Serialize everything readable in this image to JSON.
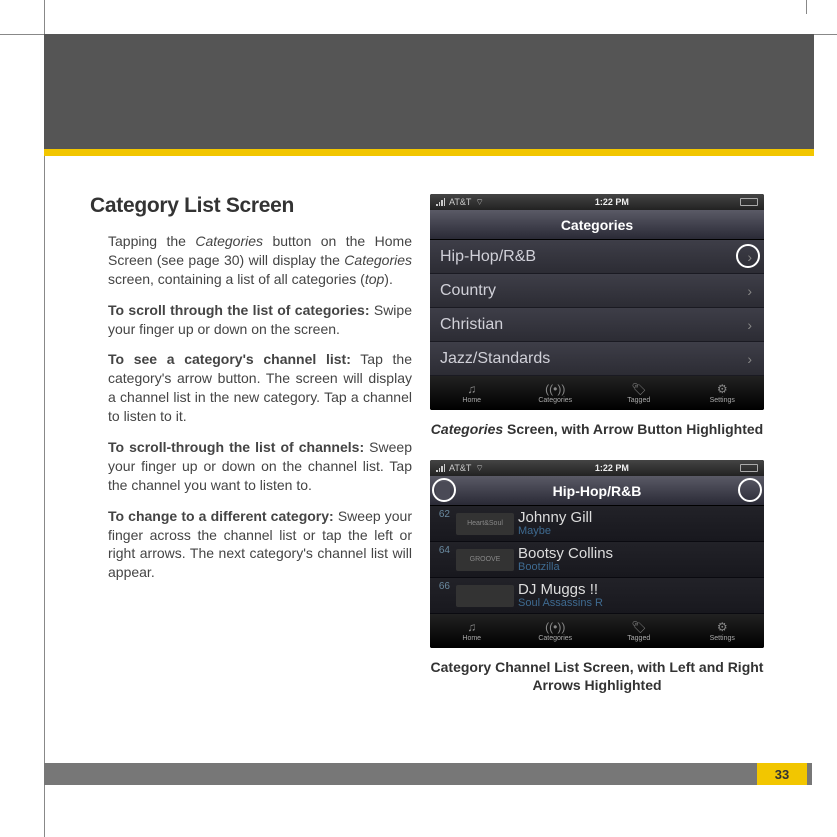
{
  "page": {
    "title": "Category List Screen",
    "number": "33"
  },
  "paragraphs": {
    "p1a": "Tapping the ",
    "p1b": "Categories",
    "p1c": " button on the Home Screen (see page 30) will display the ",
    "p1d": "Categories",
    "p1e": " screen, containing a list of all categories (",
    "p1f": "top",
    "p1g": ").",
    "p2a": "To scroll through the list of categories:",
    "p2b": " Swipe your finger up or down on the screen.",
    "p3a": "To see a category's channel list:",
    "p3b": " Tap the category's arrow button. The screen will display a channel list in the new category. Tap a channel to listen to it.",
    "p4a": "To scroll-through the list of channels:",
    "p4b": " Sweep your finger up or down on the channel list. Tap the channel you want to listen to.",
    "p5a": "To change to a different category:",
    "p5b": " Sweep your finger across the channel list or tap the left or right arrows. The next category's channel list will appear."
  },
  "status": {
    "carrier": "AT&T",
    "time": "1:22 PM"
  },
  "screen1": {
    "title": "Categories",
    "rows": [
      "Hip-Hop/R&B",
      "Country",
      "Christian",
      "Jazz/Standards"
    ]
  },
  "tabs": [
    "Home",
    "Categories",
    "Tagged",
    "Settings"
  ],
  "caption1a": "Categories",
  "caption1b": " Screen, with Arrow Button Highlighted",
  "screen2": {
    "title": "Hip-Hop/R&B",
    "rows": [
      {
        "num": "62",
        "logo": "Heart&Soul",
        "artist": "Johnny Gill",
        "song": "Maybe"
      },
      {
        "num": "64",
        "logo": "GROOVE",
        "artist": "Bootsy Collins",
        "song": "Bootzilla"
      },
      {
        "num": "66",
        "logo": "",
        "artist": "DJ Muggs !!",
        "song": "Soul Assassins R"
      }
    ]
  },
  "caption2": "Category Channel List Screen, with Left and Right Arrows Highlighted"
}
